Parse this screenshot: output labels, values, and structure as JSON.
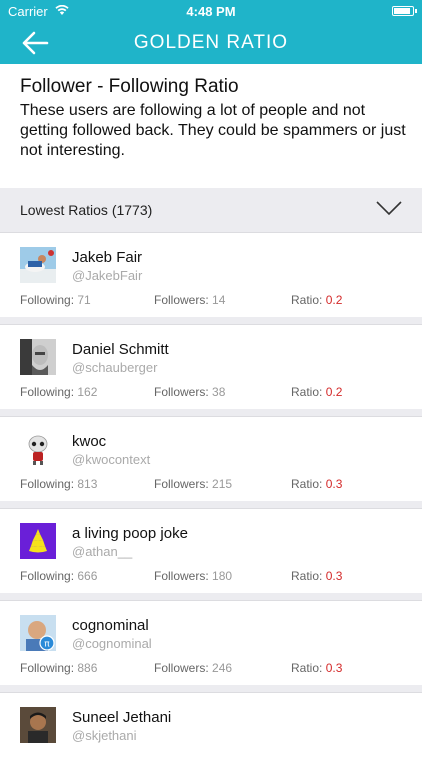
{
  "status_bar": {
    "carrier": "Carrier",
    "time": "4:48 PM"
  },
  "nav": {
    "title": "GOLDEN RATIO"
  },
  "intro": {
    "title": "Follower - Following Ratio",
    "description": "These users are following a lot of people and not getting followed back. They could be spammers or just not interesting."
  },
  "filter": {
    "label": "Lowest Ratios (1773)"
  },
  "stat_labels": {
    "following": "Following:",
    "followers": "Followers:",
    "ratio": "Ratio:"
  },
  "users": [
    {
      "name": "Jakeb Fair",
      "handle": "@JakebFair",
      "following": "71",
      "followers": "14",
      "ratio": "0.2"
    },
    {
      "name": "Daniel Schmitt",
      "handle": "@schauberger",
      "following": "162",
      "followers": "38",
      "ratio": "0.2"
    },
    {
      "name": "kwoc",
      "handle": "@kwocontext",
      "following": "813",
      "followers": "215",
      "ratio": "0.3"
    },
    {
      "name": "a living poop joke",
      "handle": "@athan__",
      "following": "666",
      "followers": "180",
      "ratio": "0.3"
    },
    {
      "name": "cognominal",
      "handle": "@cognominal",
      "following": "886",
      "followers": "246",
      "ratio": "0.3"
    },
    {
      "name": "Suneel Jethani",
      "handle": "@skjethani"
    }
  ],
  "colors": {
    "accent": "#1fb4c9",
    "ratio": "#d42a2a"
  }
}
